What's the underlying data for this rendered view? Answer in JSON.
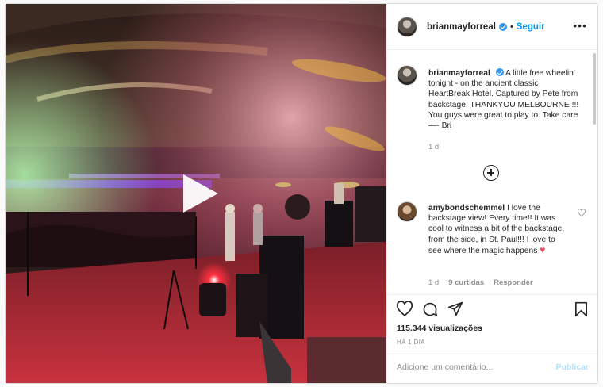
{
  "post": {
    "username": "brianmayforreal",
    "separator": "•",
    "follow_label": "Seguir",
    "more_label": "•••"
  },
  "caption": {
    "username": "brianmayforreal",
    "text": "A little free wheelin' tonight - on the ancient classic HeartBreak Hotel. Captured by Pete from backstage. THANKYOU MELBOURNE !!! You guys were great to play to. Take care —- Bri",
    "time": "1 d"
  },
  "comments": [
    {
      "username": "amybondschemmel",
      "text": "I love the backstage view! Every time!! It was cool to witness a bit of the backstage, from the side, in St. Paul!!! I love to see where the magic happens",
      "emoji": "♥",
      "time": "1 d",
      "likes": "9 curtidas",
      "reply_label": "Responder"
    }
  ],
  "stats": {
    "views": "115.344 visualizações",
    "ago": "HÁ 1 DIA"
  },
  "composer": {
    "placeholder": "Adicione um comentário...",
    "publish_label": "Publicar"
  },
  "colors": {
    "accent": "#0095f6",
    "verified": "#3897f0",
    "heart": "#ed4956"
  },
  "icons": {
    "like": "heart-icon",
    "comment": "comment-icon",
    "share": "paper-plane-icon",
    "save": "bookmark-icon",
    "play": "play-icon",
    "load_more": "plus-circle-icon"
  }
}
